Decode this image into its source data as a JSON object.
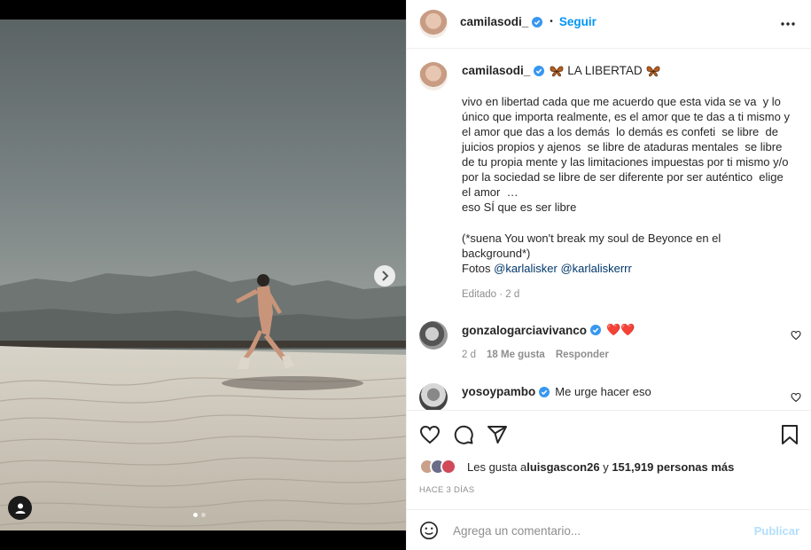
{
  "post": {
    "author": "camilasodi_",
    "follow_label": "Seguir",
    "separator": "•",
    "caption_title": "LA LIBERTAD",
    "caption_body": "vivo en libertad cada que me acuerdo que esta vida se va  y lo único que importa realmente, es el amor que te das a ti mismo y el amor que das a los demás  lo demás es confeti  se libre  de juicios propios y ajenos  se libre de ataduras mentales  se libre de tu propia mente y las limitaciones impuestas por ti mismo y/o por la sociedad se libre de ser diferente por ser auténtico  elige el amor  …\neso SÍ que es ser libre ",
    "caption_note": "(*suena You won't break my soul de Beyonce en el background*)",
    "photos_prefix": "Fotos ",
    "photo_credits": [
      "@karlalisker",
      "@karlaliskerrr"
    ],
    "edited_label": "Editado · 2 d"
  },
  "comments": [
    {
      "user": "gonzalogarciavivanco",
      "text": "❤️❤️",
      "age": "2 d",
      "likes": "18 Me gusta",
      "reply_label": "Responder"
    },
    {
      "user": "yosoypambo",
      "text": "Me urge hacer eso"
    }
  ],
  "likes": {
    "prefix": "Les gusta a ",
    "user": "luisgascon26",
    "joiner": " y ",
    "others": "151,919 personas más"
  },
  "time_ago": "HACE 3 DÍAS",
  "comment_box": {
    "placeholder": "Agrega un comentario...",
    "publish_label": "Publicar"
  },
  "carousel": {
    "current": 1,
    "total": 2
  },
  "colors": {
    "accent": "#0095f6",
    "verified": "#3897f0",
    "butterfly": "#b65d1e",
    "heart": "#ed4956"
  },
  "icons": [
    "ellipsis-icon",
    "verified-icon",
    "heart-icon",
    "comment-icon",
    "share-icon",
    "bookmark-icon",
    "emoji-icon",
    "chevron-right-icon",
    "user-tag-icon",
    "butterfly-icon"
  ]
}
